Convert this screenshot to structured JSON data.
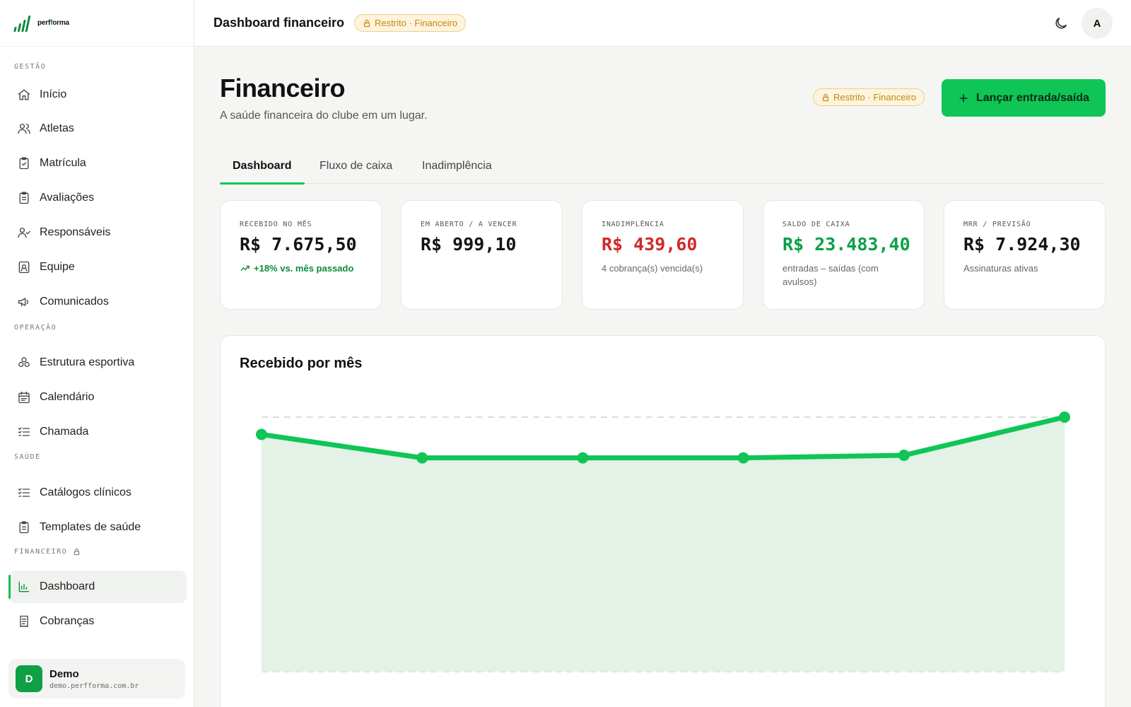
{
  "brand": {
    "name_prefix": "perf",
    "name_suffix": "orma",
    "name_accent": "f"
  },
  "sidebar": {
    "sections": [
      {
        "title": "GESTÃO",
        "items": [
          {
            "label": "Início",
            "icon": "home-icon"
          },
          {
            "label": "Atletas",
            "icon": "users-icon"
          },
          {
            "label": "Matrícula",
            "icon": "clipboard-check-icon"
          },
          {
            "label": "Avaliações",
            "icon": "clipboard-list-icon"
          },
          {
            "label": "Responsáveis",
            "icon": "user-check-icon"
          },
          {
            "label": "Equipe",
            "icon": "id-badge-icon"
          },
          {
            "label": "Comunicados",
            "icon": "megaphone-icon"
          }
        ]
      },
      {
        "title": "OPERAÇÃO",
        "items": [
          {
            "label": "Estrutura esportiva",
            "icon": "cubes-icon"
          },
          {
            "label": "Calendário",
            "icon": "calendar-icon"
          },
          {
            "label": "Chamada",
            "icon": "list-check-icon"
          }
        ]
      },
      {
        "title": "SAÚDE",
        "items": [
          {
            "label": "Catálogos clínicos",
            "icon": "list-check-icon"
          },
          {
            "label": "Templates de saúde",
            "icon": "clipboard-list-icon"
          }
        ]
      },
      {
        "title": "FINANCEIRO",
        "locked": true,
        "items": [
          {
            "label": "Dashboard",
            "icon": "bar-chart-icon",
            "active": true
          },
          {
            "label": "Cobranças",
            "icon": "receipt-icon"
          }
        ]
      }
    ],
    "user": {
      "initial": "D",
      "name": "Demo",
      "domain": "demo.perfforma.com.br"
    }
  },
  "topbar": {
    "title": "Dashboard financeiro",
    "badge": "Restrito · Financeiro",
    "avatar_initial": "A"
  },
  "header": {
    "title": "Financeiro",
    "subtitle": "A saúde financeira do clube em um lugar.",
    "badge": "Restrito · Financeiro",
    "primary_action": "Lançar entrada/saída"
  },
  "tabs": [
    {
      "label": "Dashboard",
      "active": true
    },
    {
      "label": "Fluxo de caixa"
    },
    {
      "label": "Inadimplência"
    }
  ],
  "kpis": [
    {
      "label": "RECEBIDO NO MÊS",
      "value": "R$ 7.675,50",
      "note": "+18% vs. mês passado",
      "tone": "default",
      "note_style": "trend"
    },
    {
      "label": "EM ABERTO / A VENCER",
      "value": "R$ 999,10",
      "note": "",
      "tone": "default"
    },
    {
      "label": "INADIMPLÊNCIA",
      "value": "R$ 439,60",
      "note": "4 cobrança(s) vencida(s)",
      "tone": "red"
    },
    {
      "label": "SALDO DE CAIXA",
      "value": "R$ 23.483,40",
      "note": "entradas – saídas (com avulsos)",
      "tone": "green"
    },
    {
      "label": "MRR / PREVISÃO",
      "value": "R$ 7.924,30",
      "note": "Assinaturas ativas",
      "tone": "default"
    }
  ],
  "chart": {
    "title": "Recebido por mês",
    "colors": {
      "line": "#0fc556",
      "fill": "#e3f1e7",
      "grid": "#dcdcd8"
    }
  },
  "chart_data": {
    "type": "area",
    "title": "Recebido por mês",
    "xlabel": "",
    "ylabel": "",
    "x": [
      1,
      2,
      3,
      4,
      5,
      6
    ],
    "values": [
      0.932,
      0.84,
      0.84,
      0.84,
      0.85,
      1.0
    ],
    "ylim": [
      0,
      1
    ],
    "grid": true
  }
}
